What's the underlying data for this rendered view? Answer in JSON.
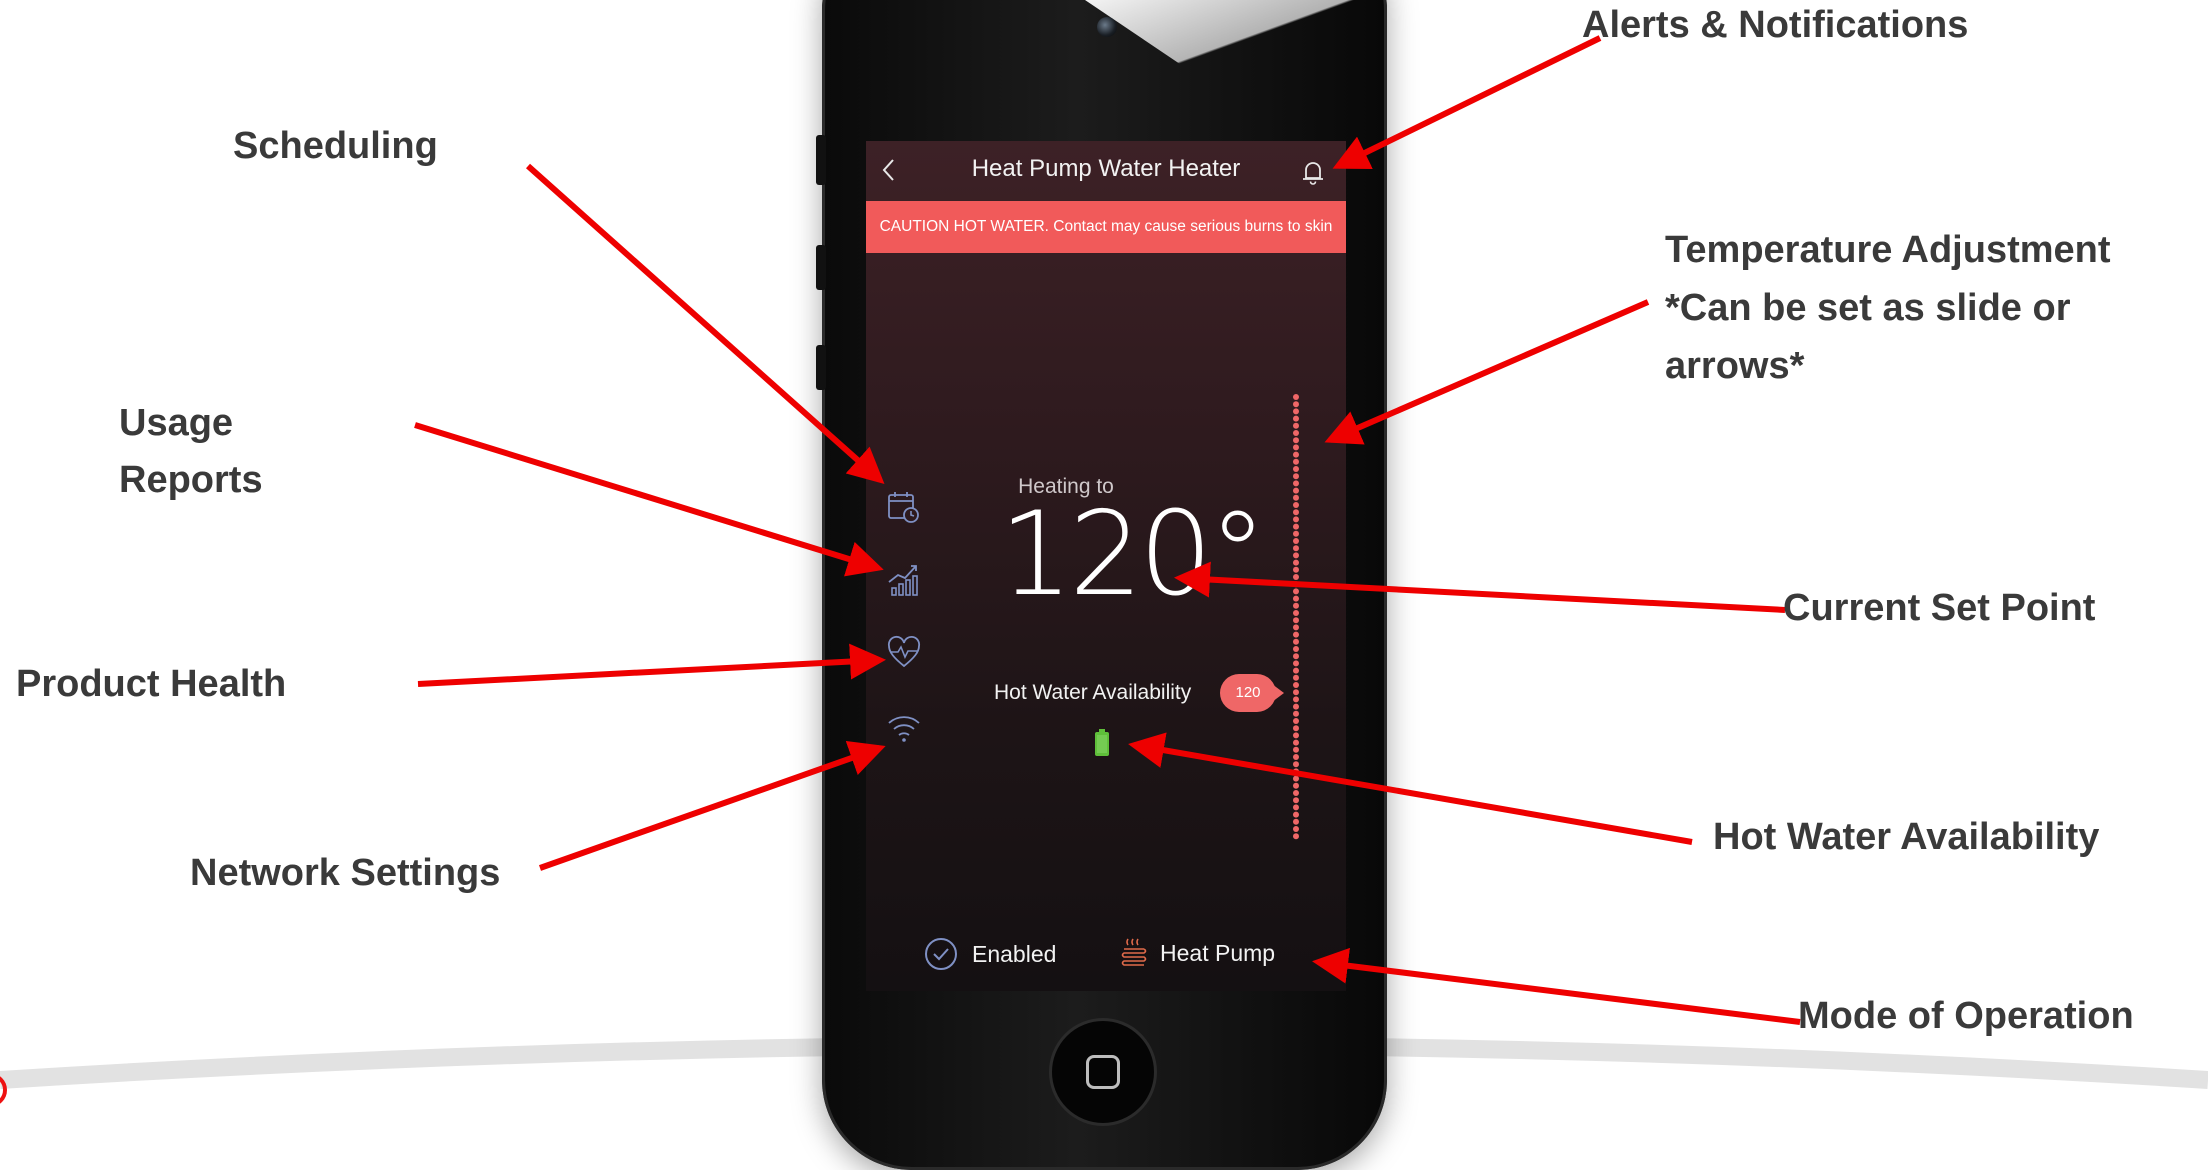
{
  "callouts": {
    "scheduling": "Scheduling",
    "usage_reports_line1": "Usage",
    "usage_reports_line2": "Reports",
    "product_health": "Product Health",
    "network_settings": "Network Settings",
    "alerts": "Alerts & Notifications",
    "temp_adjust_line1": "Temperature Adjustment",
    "temp_adjust_line2": "*Can be set as slide or",
    "temp_adjust_line3": "arrows*",
    "current_set_point": "Current Set Point",
    "hot_water_availability": "Hot Water Availability",
    "mode_of_operation": "Mode of Operation"
  },
  "app": {
    "title": "Heat Pump Water Heater",
    "caution": "CAUTION HOT WATER. Contact may cause serious burns to skin",
    "heating_label": "Heating to",
    "set_point": "120°",
    "hwa_label": "Hot Water Availability",
    "slider_value": "120",
    "status": "Enabled",
    "mode": "Heat Pump"
  },
  "icons": {
    "back": "chevron-left-icon",
    "alerts": "bell-icon",
    "scheduling": "calendar-clock-icon",
    "usage": "bar-chart-trend-icon",
    "health": "heart-pulse-icon",
    "network": "wifi-icon",
    "availability": "battery-icon",
    "status": "check-circle-icon",
    "mode": "heat-coil-icon"
  },
  "colors": {
    "arrow": "#ee0000",
    "caution_banner": "#f15a5a",
    "slider_dots": "#ef6767",
    "icon_blue": "#7f90c4",
    "battery_green": "#5fbf3a"
  }
}
